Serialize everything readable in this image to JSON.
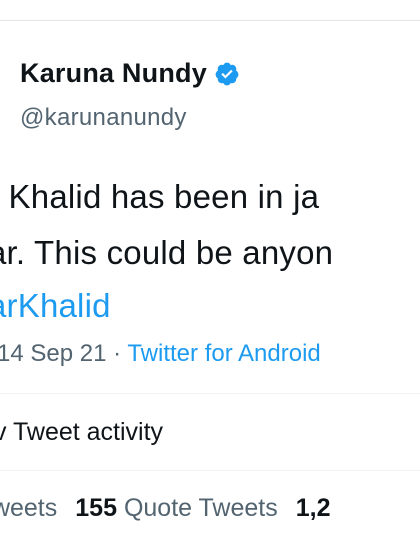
{
  "author": {
    "name": "Karuna Nundy",
    "handle": "@karunanundy",
    "verified_icon": "verified-badge-icon"
  },
  "tweet": {
    "line1": "r Khalid has been in ja",
    "line2": "ar. This could be anyon",
    "line3": "arKhalid"
  },
  "meta": {
    "date": "14 Sep 21",
    "separator": "·",
    "source": "Twitter for Android"
  },
  "activity": {
    "label": "v Tweet activity"
  },
  "stats": {
    "retweets_label": "tweets",
    "quote_count": "155",
    "quote_label": "Quote Tweets",
    "likes_partial": "1,2"
  },
  "colors": {
    "link": "#1d9bf0",
    "secondary_text": "#536471",
    "primary_text": "#0f1419"
  }
}
